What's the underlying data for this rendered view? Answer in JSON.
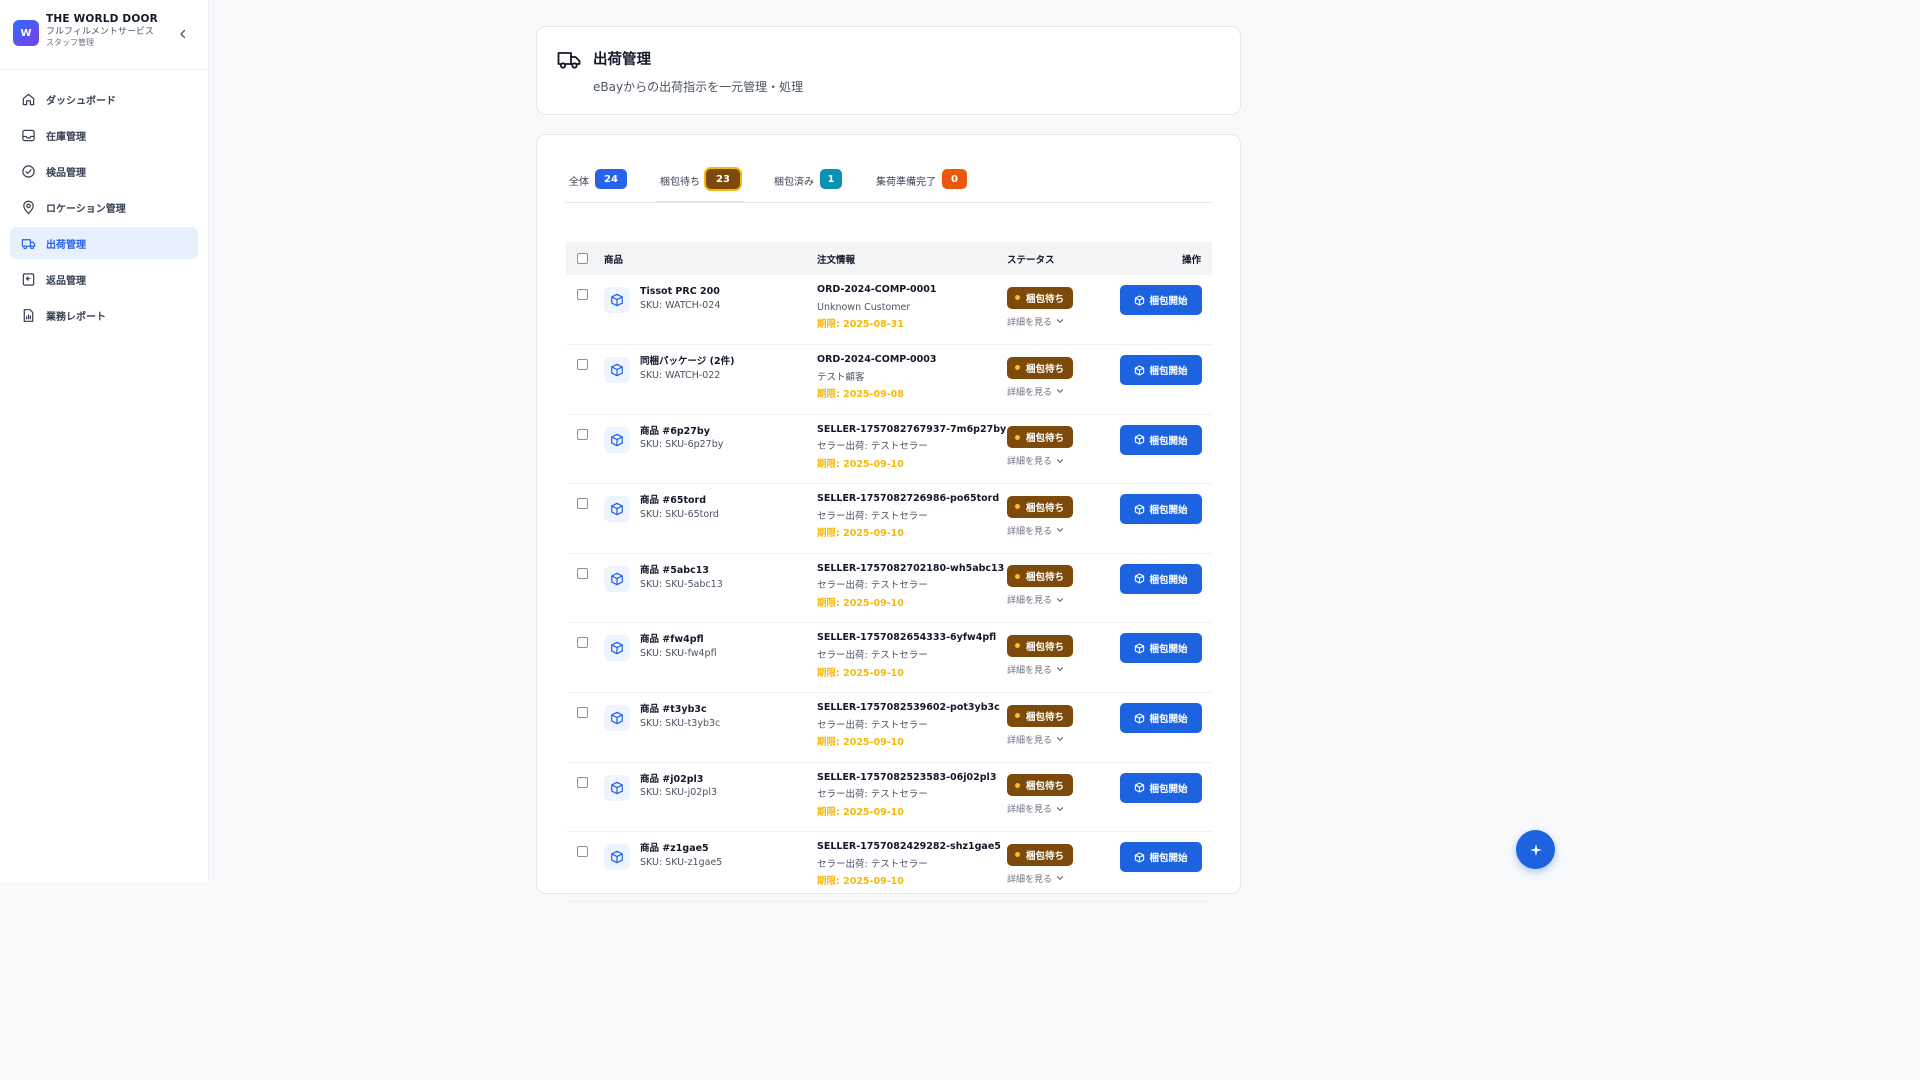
{
  "brand": {
    "logo_letter": "W",
    "name": "THE WORLD DOOR",
    "subtitle": "フルフィルメントサービス",
    "role": "スタッフ管理"
  },
  "sidebar": {
    "items": [
      {
        "label": "ダッシュボード",
        "icon": "home-icon",
        "active": false
      },
      {
        "label": "在庫管理",
        "icon": "inbox-icon",
        "active": false
      },
      {
        "label": "検品管理",
        "icon": "check-circle-icon",
        "active": false
      },
      {
        "label": "ロケーション管理",
        "icon": "map-pin-icon",
        "active": false
      },
      {
        "label": "出荷管理",
        "icon": "truck-icon",
        "active": true
      },
      {
        "label": "返品管理",
        "icon": "return-icon",
        "active": false
      },
      {
        "label": "業務レポート",
        "icon": "report-icon",
        "active": false
      }
    ]
  },
  "header": {
    "title": "出荷管理",
    "subtitle": "eBayからの出荷指示を一元管理・処理"
  },
  "tabs": [
    {
      "label": "全体",
      "count": "24",
      "color": "#2563eb"
    },
    {
      "label": "梱包待ち",
      "count": "23",
      "color": "#7c4a0a"
    },
    {
      "label": "梱包済み",
      "count": "1",
      "color": "#0891b2"
    },
    {
      "label": "集荷準備完了",
      "count": "0",
      "color": "#ea580c"
    }
  ],
  "table": {
    "columns": {
      "product": "商品",
      "order": "注文情報",
      "status": "ステータス",
      "action": "操作"
    },
    "status_label": "梱包待ち",
    "detail_label": "詳細を見る",
    "action_label": "梱包開始",
    "rows": [
      {
        "name": "Tissot PRC 200",
        "sku": "SKU: WATCH-024",
        "order_no": "ORD-2024-COMP-0001",
        "customer": "Unknown Customer",
        "due": "期限: 2025-08-31"
      },
      {
        "name": "同梱パッケージ (2件)",
        "sku": "SKU: WATCH-022",
        "order_no": "ORD-2024-COMP-0003",
        "customer": "テスト顧客",
        "due": "期限: 2025-09-08"
      },
      {
        "name": "商品 #6p27by",
        "sku": "SKU: SKU-6p27by",
        "order_no": "SELLER-1757082767937-7m6p27by",
        "customer": "セラー出荷: テストセラー",
        "due": "期限: 2025-09-10"
      },
      {
        "name": "商品 #65tord",
        "sku": "SKU: SKU-65tord",
        "order_no": "SELLER-1757082726986-po65tord",
        "customer": "セラー出荷: テストセラー",
        "due": "期限: 2025-09-10"
      },
      {
        "name": "商品 #5abc13",
        "sku": "SKU: SKU-5abc13",
        "order_no": "SELLER-1757082702180-wh5abc13",
        "customer": "セラー出荷: テストセラー",
        "due": "期限: 2025-09-10"
      },
      {
        "name": "商品 #fw4pfl",
        "sku": "SKU: SKU-fw4pfl",
        "order_no": "SELLER-1757082654333-6yfw4pfl",
        "customer": "セラー出荷: テストセラー",
        "due": "期限: 2025-09-10"
      },
      {
        "name": "商品 #t3yb3c",
        "sku": "SKU: SKU-t3yb3c",
        "order_no": "SELLER-1757082539602-pot3yb3c",
        "customer": "セラー出荷: テストセラー",
        "due": "期限: 2025-09-10"
      },
      {
        "name": "商品 #j02pl3",
        "sku": "SKU: SKU-j02pl3",
        "order_no": "SELLER-1757082523583-06j02pl3",
        "customer": "セラー出荷: テストセラー",
        "due": "期限: 2025-09-10"
      },
      {
        "name": "商品 #z1gae5",
        "sku": "SKU: SKU-z1gae5",
        "order_no": "SELLER-1757082429282-shz1gae5",
        "customer": "セラー出荷: テストセラー",
        "due": "期限: 2025-09-10"
      }
    ]
  },
  "colors": {
    "accent": "#2563eb",
    "status_badge": "#7c4a0a",
    "due_date": "#f5b90b",
    "action_button": "#1d63e0"
  },
  "fab": {
    "icon": "sparkle-icon"
  }
}
